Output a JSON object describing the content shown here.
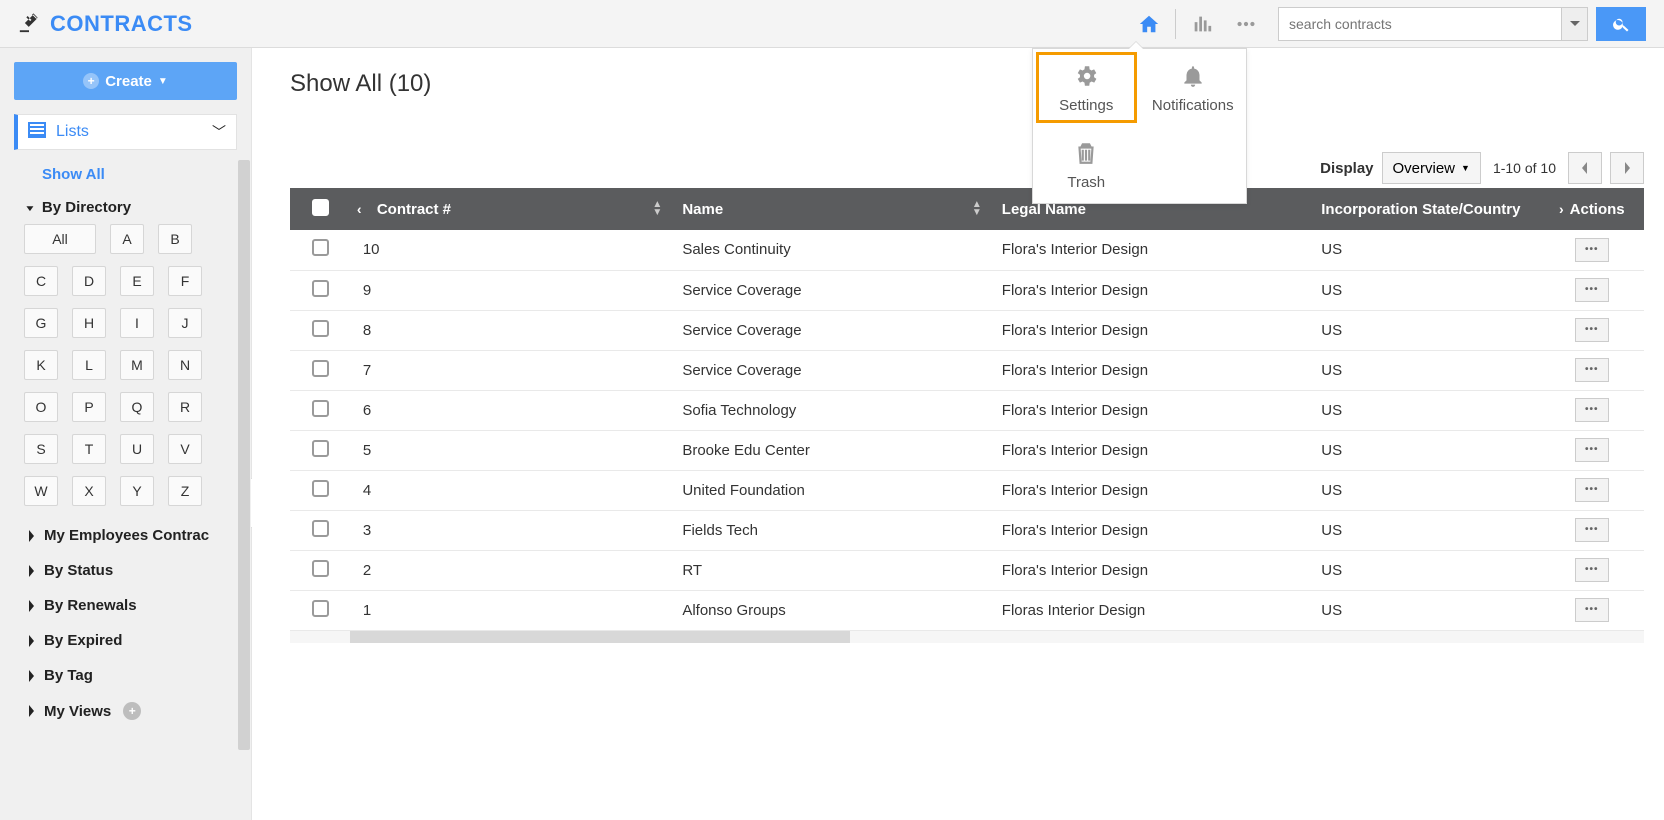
{
  "brand": {
    "text": "CONTRACTS"
  },
  "search": {
    "placeholder": "search contracts"
  },
  "more_menu": {
    "settings": "Settings",
    "notifications": "Notifications",
    "trash": "Trash"
  },
  "sidebar": {
    "create": "Create",
    "lists": "Lists",
    "show_all": "Show All",
    "by_directory": "By Directory",
    "all": "All",
    "letters": [
      "A",
      "B",
      "C",
      "D",
      "E",
      "F",
      "G",
      "H",
      "I",
      "J",
      "K",
      "L",
      "M",
      "N",
      "O",
      "P",
      "Q",
      "R",
      "S",
      "T",
      "U",
      "V",
      "W",
      "X",
      "Y",
      "Z"
    ],
    "links": [
      "My Employees Contrac",
      "By Status",
      "By Renewals",
      "By Expired",
      "By Tag",
      "My Views"
    ]
  },
  "page": {
    "title": "Show All  (10)",
    "display_label": "Display",
    "display_value": "Overview",
    "range": "1-10 of 10"
  },
  "table": {
    "cols": {
      "num": "Contract #",
      "name": "Name",
      "legal": "Legal Name",
      "inc": "Incorporation State/Country",
      "actions": "Actions"
    },
    "rows": [
      {
        "num": "10",
        "name": "Sales Continuity",
        "legal": "Flora's Interior Design",
        "inc": "US"
      },
      {
        "num": "9",
        "name": "Service Coverage",
        "legal": "Flora's Interior Design",
        "inc": "US"
      },
      {
        "num": "8",
        "name": "Service Coverage",
        "legal": "Flora's Interior Design",
        "inc": "US"
      },
      {
        "num": "7",
        "name": "Service Coverage",
        "legal": "Flora's Interior Design",
        "inc": "US"
      },
      {
        "num": "6",
        "name": "Sofia Technology",
        "legal": "Flora's Interior Design",
        "inc": "US"
      },
      {
        "num": "5",
        "name": "Brooke Edu Center",
        "legal": "Flora's Interior Design",
        "inc": "US"
      },
      {
        "num": "4",
        "name": "United Foundation",
        "legal": "Flora's Interior Design",
        "inc": "US"
      },
      {
        "num": "3",
        "name": "Fields Tech",
        "legal": "Flora's Interior Design",
        "inc": "US"
      },
      {
        "num": "2",
        "name": "RT",
        "legal": "Flora's Interior Design",
        "inc": "US"
      },
      {
        "num": "1",
        "name": "Alfonso Groups",
        "legal": "Floras Interior Design",
        "inc": "US"
      }
    ]
  }
}
